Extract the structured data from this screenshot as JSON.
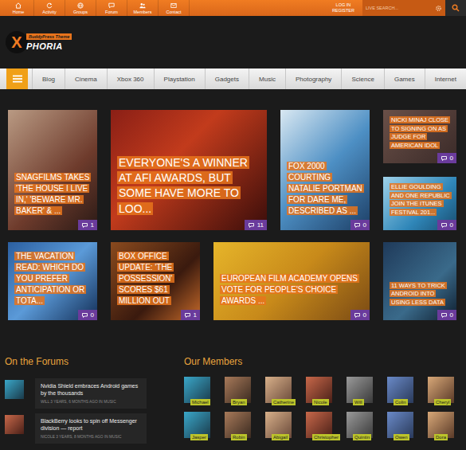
{
  "topbar": {
    "links": [
      {
        "label": "Home"
      },
      {
        "label": "Activity"
      },
      {
        "label": "Groups"
      },
      {
        "label": "Forum"
      },
      {
        "label": "Members"
      },
      {
        "label": "Contact"
      }
    ],
    "login": "LOG IN",
    "register": "REGISTER",
    "search": {
      "placeholder": "LIVE SEARCH..."
    }
  },
  "logo": {
    "mark": "X",
    "badge": "BuddyPress Theme",
    "name": "PHORIA"
  },
  "nav": {
    "items": [
      {
        "label": "Blog",
        "selected": false
      },
      {
        "label": "Cinema",
        "selected": false
      },
      {
        "label": "Xbox 360",
        "selected": false
      },
      {
        "label": "Playstation",
        "selected": false
      },
      {
        "label": "Gadgets",
        "selected": false
      },
      {
        "label": "Music",
        "selected": false
      },
      {
        "label": "Photography",
        "selected": false
      },
      {
        "label": "Science",
        "selected": false
      },
      {
        "label": "Games",
        "selected": false
      },
      {
        "label": "Internet",
        "selected": false
      }
    ]
  },
  "featured": [
    {
      "title": "SNAGFILMS TAKES 'THE HOUSE I LIVE IN,' 'BEWARE MR. BAKER' & ...",
      "comments": "1"
    },
    {
      "title": "EVERYONE'S A WINNER AT AFI AWARDS, BUT SOME HAVE MORE TO LOO...",
      "comments": "11"
    },
    {
      "title": "FOX 2000 COURTING NATALIE PORTMAN FOR DARE ME, DESCRIBED AS ...",
      "comments": "0"
    },
    {
      "title": "NICKI MINAJ CLOSE TO SIGNING ON AS JUDGE FOR AMERICAN IDOL",
      "comments": "0"
    },
    {
      "title": "ELLIE GOULDING AND ONE REPUBLIC JOIN THE ITUNES FESTIVAL 201...",
      "comments": "0"
    },
    {
      "title": "THE VACATION READ: WHICH DO YOU PREFER ANTICIPATION OR TOTA...",
      "comments": "0"
    },
    {
      "title": "BOX OFFICE UPDATE: 'THE POSSESSION' SCORES $61 MILLION OUT",
      "comments": "1"
    },
    {
      "title": "EUROPEAN FILM ACADEMY OPENS VOTE FOR PEOPLE'S CHOICE AWARDS ...",
      "comments": "0"
    },
    {
      "title": "11 WAYS TO TRICK ANDROID INTO USING LESS DATA",
      "comments": "0"
    }
  ],
  "forums": {
    "title": "On the Forums",
    "posts": [
      {
        "title": "Nvidia Shield embraces Android games by the thousands",
        "meta": "WILL 3 YEARS, 6 MONTHS AGO IN MUSIC"
      },
      {
        "title": "BlackBerry looks to spin off Messenger division — report",
        "meta": "NICOLE 3 YEARS, 8 MONTHS AGO IN MUSIC"
      }
    ]
  },
  "members": {
    "title": "Our Members",
    "people": [
      "Michael",
      "Bryan",
      "Catherine",
      "Nicole",
      "Will",
      "Colin",
      "Cheryl",
      "Jasper",
      "Robin",
      "Abigail",
      "Christopher",
      "Quintin",
      "Owen",
      "Dora"
    ]
  }
}
